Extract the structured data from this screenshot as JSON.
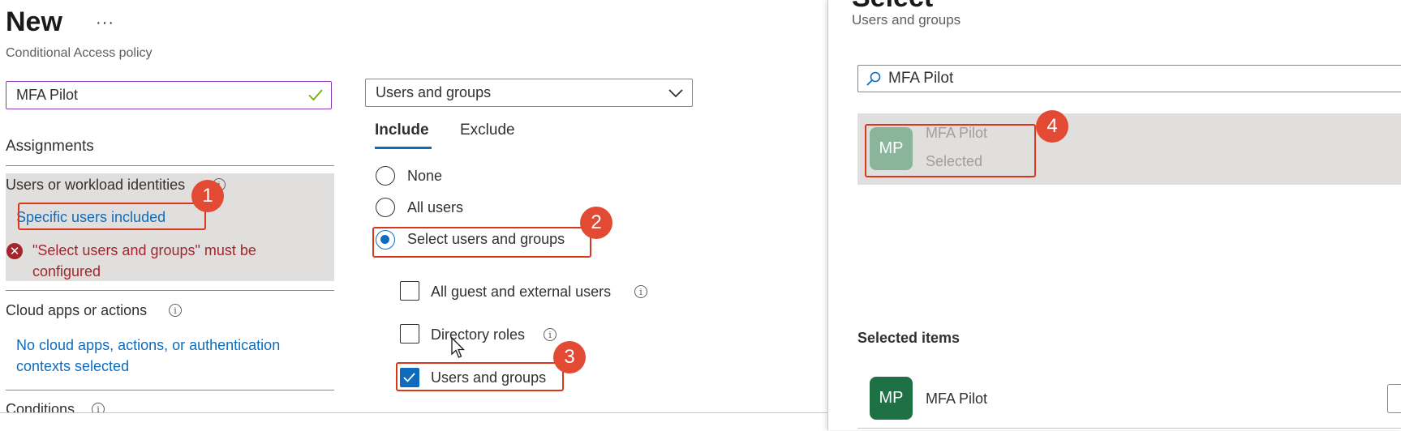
{
  "header": {
    "title": "New",
    "more_label": "···",
    "subtitle": "Conditional Access policy"
  },
  "policy_name": {
    "value": "MFA Pilot"
  },
  "assignments": {
    "title": "Assignments",
    "users_label": "Users or workload identities",
    "users_link": "Specific users included",
    "error_text": "\"Select users and groups\" must be configured",
    "cloud_label": "Cloud apps or actions",
    "cloud_link": "No cloud apps, actions, or authentication contexts selected",
    "conditions_label": "Conditions"
  },
  "scope": {
    "dropdown_value": "Users and groups",
    "tabs": [
      {
        "label": "Include",
        "active": true
      },
      {
        "label": "Exclude",
        "active": false
      }
    ],
    "radios": [
      {
        "label": "None",
        "checked": false
      },
      {
        "label": "All users",
        "checked": false
      },
      {
        "label": "Select users and groups",
        "checked": true
      }
    ],
    "checkboxes": [
      {
        "label": "All guest and external users",
        "checked": false,
        "info": true
      },
      {
        "label": "Directory roles",
        "checked": false,
        "info": true
      },
      {
        "label": "Users and groups",
        "checked": true,
        "info": false
      }
    ]
  },
  "panel": {
    "title": "Select",
    "subtitle": "Users and groups",
    "search_value": "MFA Pilot",
    "result": {
      "initials": "MP",
      "name": "MFA Pilot",
      "status": "Selected",
      "avatar_color": "#8ab59b"
    },
    "selected_items_title": "Selected items",
    "selected_items": [
      {
        "initials": "MP",
        "name": "MFA Pilot",
        "avatar_color": "#1e7145"
      }
    ]
  },
  "callouts": [
    "1",
    "2",
    "3",
    "4"
  ],
  "colors": {
    "accent": "#0f6cbd",
    "error": "#a4262c",
    "callout": "#e34a33",
    "input_focus_border": "#8a3ab9",
    "valid_check": "#6bb700"
  },
  "icons": [
    "more-icon",
    "checkmark-icon",
    "info-icon",
    "error-icon",
    "chevron-down-icon",
    "search-icon",
    "mouse-cursor-icon"
  ]
}
